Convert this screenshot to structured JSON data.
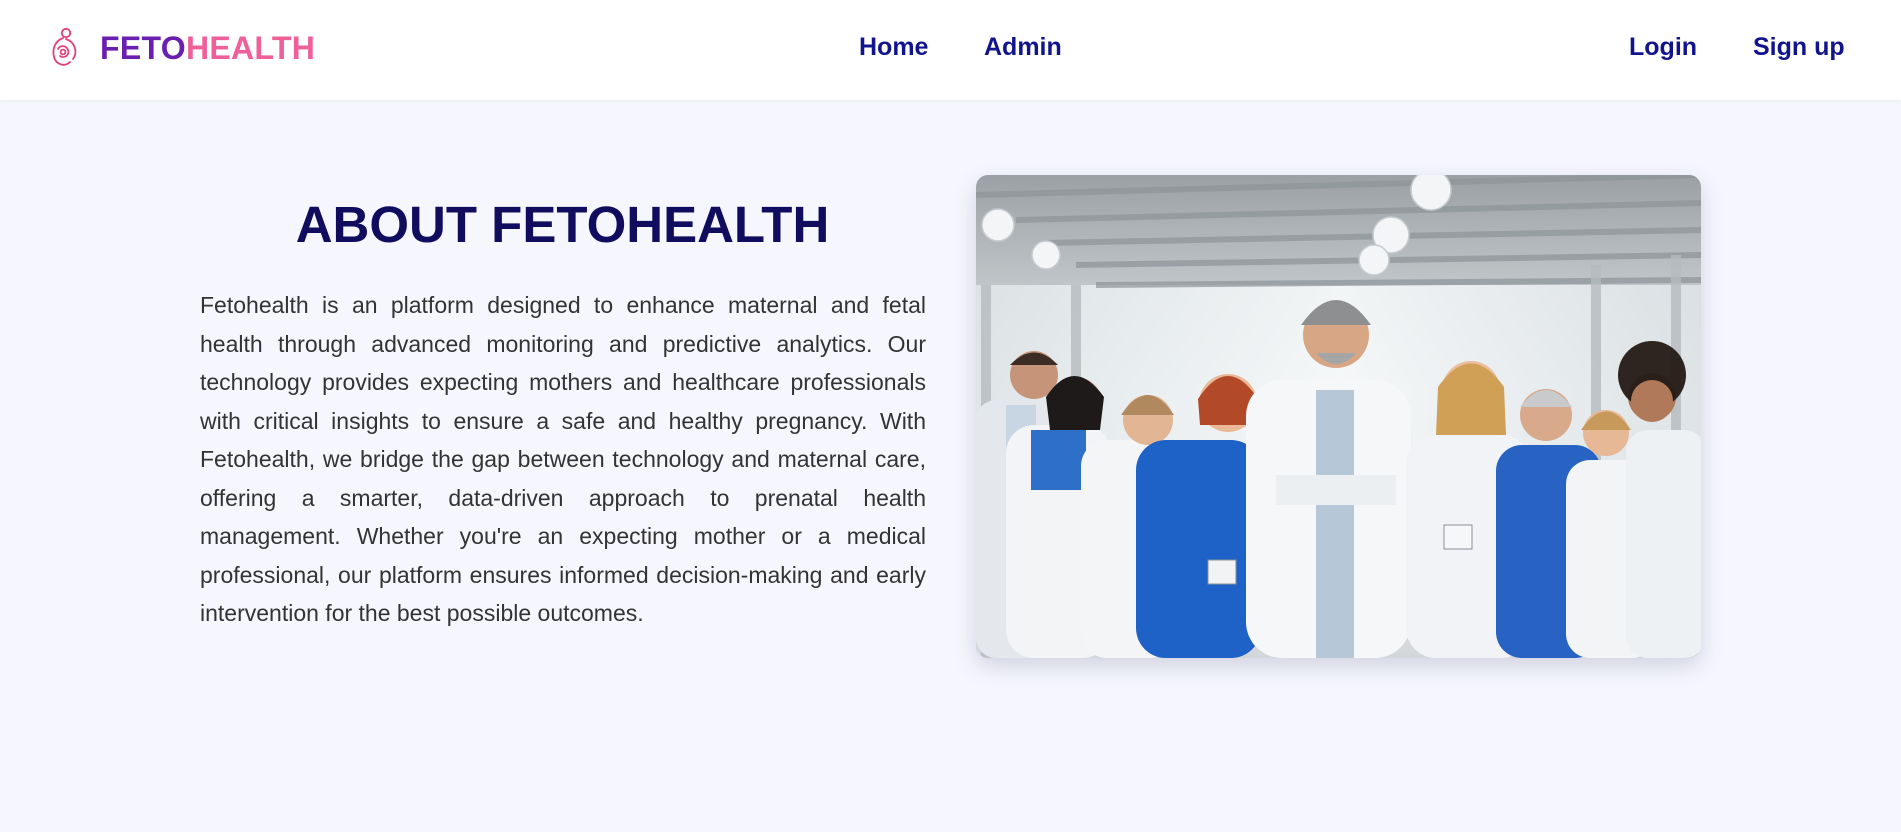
{
  "brand": {
    "name_part1": "FETO",
    "name_part2": "HEALTH",
    "logo_icon": "pregnancy-icon",
    "colors": {
      "part1": "#6a1fb0",
      "part2": "#ef5f9a"
    }
  },
  "nav": {
    "center_links": [
      "Home",
      "Admin"
    ],
    "right_links": [
      "Login",
      "Sign up"
    ],
    "link_color": "#11148c"
  },
  "about": {
    "title": "ABOUT FETOHEALTH",
    "text": "Fetohealth is an platform designed to enhance maternal and fetal health through advanced monitoring and predictive analytics. Our technology provides expecting mothers and healthcare professionals with critical insights to ensure a safe and healthy pregnancy. With Fetohealth, we bridge the gap between technology and maternal care, offering a smarter, data-driven approach to prenatal health management. Whether you're an expecting mother or a medical professional, our platform ensures informed decision-making and early intervention for the best possible outcomes."
  },
  "colors": {
    "page_background": "#f6f7fe",
    "title": "#100c5e",
    "body_text": "#333333"
  }
}
